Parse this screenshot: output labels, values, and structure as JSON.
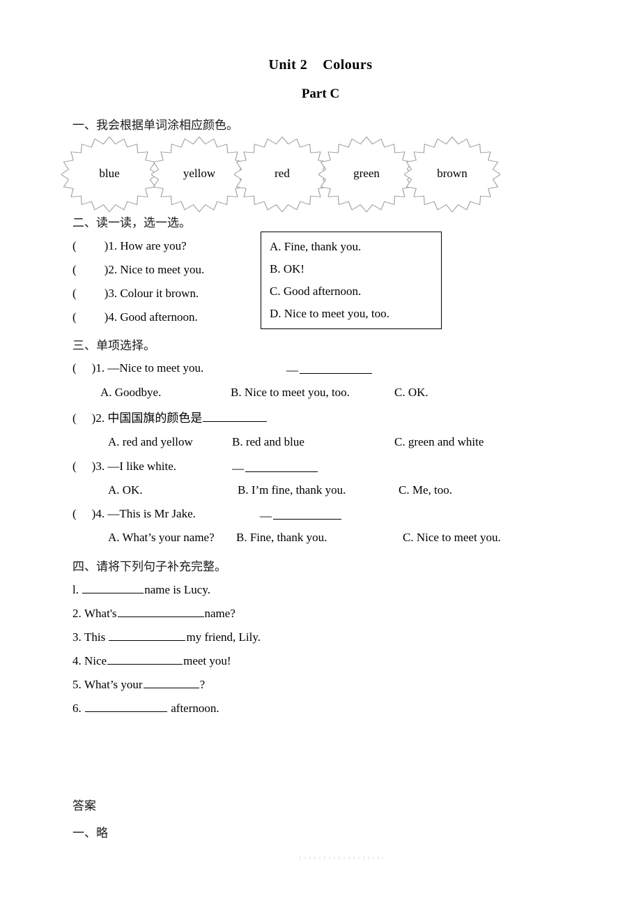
{
  "header": {
    "unit_title": "Unit 2",
    "unit_name": "Colours",
    "part_title": "Part C"
  },
  "section1": {
    "heading": "一、我会根据单词涂相应颜色。",
    "flowers": [
      {
        "word": "blue"
      },
      {
        "word": "yellow"
      },
      {
        "word": "red"
      },
      {
        "word": "green"
      },
      {
        "word": "brown"
      }
    ]
  },
  "section2": {
    "heading": "二、读一读，选一选。",
    "items": [
      {
        "open": "(",
        "close": ")",
        "num": "1.",
        "text": "How are you?"
      },
      {
        "open": "(",
        "close": ")",
        "num": "2.",
        "text": "Nice to meet you."
      },
      {
        "open": "(",
        "close": ")",
        "num": "3.",
        "text": "Colour it brown."
      },
      {
        "open": "(",
        "close": ")",
        "num": "4.",
        "text": "Good afternoon."
      }
    ],
    "options": [
      "A. Fine, thank you.",
      "B. OK!",
      "C. Good afternoon.",
      "D. Nice to meet you, too."
    ]
  },
  "section3": {
    "heading": "三、单项选择。",
    "q1": {
      "open": "(",
      "close": ")",
      "num": "1.",
      "prompt": "—Nice to meet you.",
      "reply_dash": "—",
      "choice_a": "A. Goodbye.",
      "choice_b": "B. Nice to meet you, too.",
      "choice_c": "C. OK."
    },
    "q2": {
      "open": "(",
      "close": ")",
      "num": "2.",
      "prompt": "中国国旗的颜色是",
      "choice_a": "A. red and yellow",
      "choice_b": "B. red and blue",
      "choice_c": "C. green and white"
    },
    "q3": {
      "open": "(",
      "close": ")",
      "num": "3.",
      "prompt": "—I like white.",
      "reply_dash": "—",
      "choice_a": "A. OK.",
      "choice_b": "B. I’m fine, thank you.",
      "choice_c": "C. Me, too."
    },
    "q4": {
      "open": "(",
      "close": ")",
      "num": "4.",
      "prompt": "—This is Mr Jake.",
      "reply_dash": "—",
      "choice_a": "A. What’s your name?",
      "choice_b": "B. Fine, thank you.",
      "choice_c": "C. Nice to meet you."
    }
  },
  "section4": {
    "heading": "四、请将下列句子补充完整。",
    "items": [
      {
        "num": "l.",
        "before": "",
        "after": "name is Lucy."
      },
      {
        "num": "2.",
        "before": "What's",
        "after": "name?"
      },
      {
        "num": "3.",
        "before": "This ",
        "after": "my friend, Lily."
      },
      {
        "num": "4.",
        "before": "Nice",
        "after": "meet you!"
      },
      {
        "num": "5.",
        "before": "What’s your",
        "after": "?"
      },
      {
        "num": "6.",
        "before": "",
        "after": " afternoon."
      }
    ]
  },
  "answers": {
    "heading": "答案",
    "first": "一、略"
  }
}
